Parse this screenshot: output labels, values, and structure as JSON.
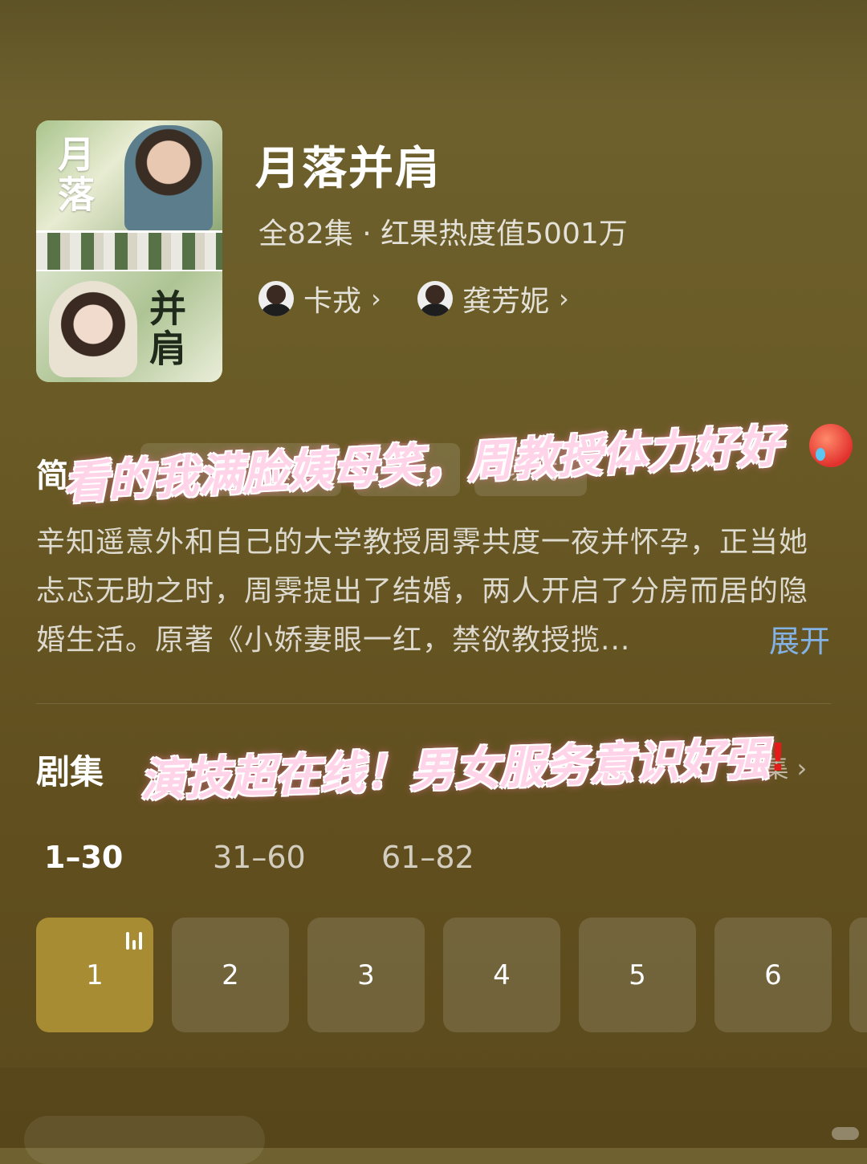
{
  "show": {
    "title": "月落并肩",
    "meta": "全82集 · 红果热度值5001万",
    "cast": [
      {
        "name": "卡戎"
      },
      {
        "name": "龚芳妮"
      }
    ]
  },
  "intro": {
    "heading": "简",
    "tags": [
      "龄差",
      "",
      "现代"
    ],
    "synopsis": "辛知遥意外和自己的大学教授周霁共度一夜并怀孕，正当她忐忑无助之时，周霁提出了结婚，两人开启了分房而居的隐婚生活。原著《小娇妻眼一红，禁欲教授揽...",
    "expand_label": "展开"
  },
  "episodes": {
    "heading": "剧集",
    "total_label": "2集",
    "ranges": [
      "1–30",
      "31–60",
      "61–82"
    ],
    "active_range": 0,
    "tiles": [
      "1",
      "2",
      "3",
      "4",
      "5",
      "6"
    ],
    "active_tile": 0
  },
  "overlay": {
    "caption1": "看的我满脸姨母笑，周教授体力好好",
    "caption2": "演技超在线！男女服务意识好强",
    "bang": "!"
  },
  "colors": {
    "background": "#6a5b26",
    "active_tile": "#a88c34",
    "expand_link": "#84b2e4",
    "caption_pink": "#ffd4e8"
  }
}
